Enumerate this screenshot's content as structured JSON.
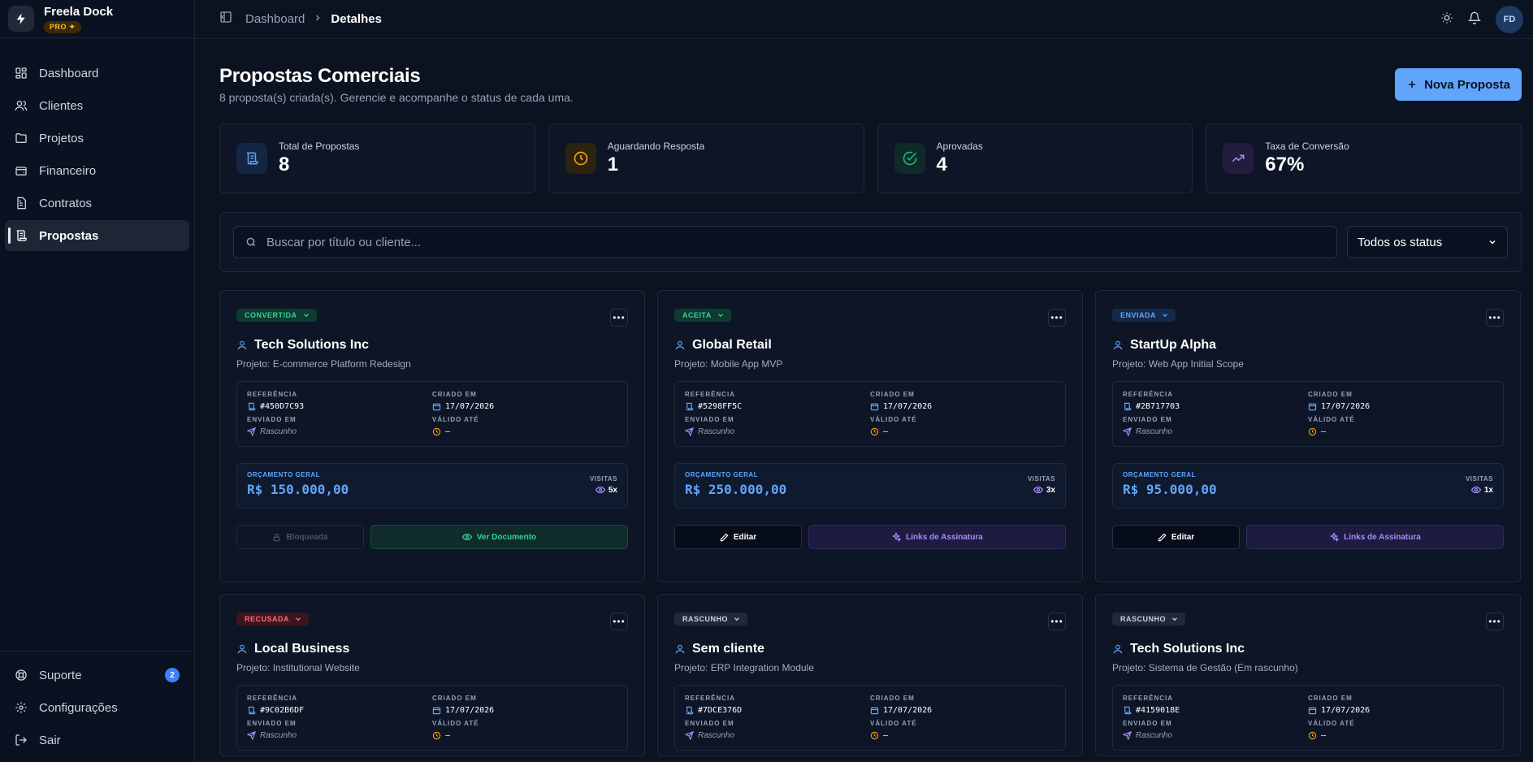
{
  "brand": {
    "name": "Freela Dock",
    "badge": "PRO ✦"
  },
  "sidebar": {
    "items": [
      {
        "label": "Dashboard",
        "icon": "dashboard-icon"
      },
      {
        "label": "Clientes",
        "icon": "users-icon"
      },
      {
        "label": "Projetos",
        "icon": "folder-icon"
      },
      {
        "label": "Financeiro",
        "icon": "wallet-icon"
      },
      {
        "label": "Contratos",
        "icon": "document-icon"
      },
      {
        "label": "Propostas",
        "icon": "scroll-icon",
        "active": true
      }
    ],
    "bottom": [
      {
        "label": "Suporte",
        "icon": "lifebuoy-icon",
        "badge": "2"
      },
      {
        "label": "Configurações",
        "icon": "gear-icon"
      },
      {
        "label": "Sair",
        "icon": "logout-icon"
      }
    ]
  },
  "topbar": {
    "breadcrumb": [
      "Dashboard",
      "Detalhes"
    ],
    "avatar": "FD"
  },
  "page": {
    "title": "Propostas Comerciais",
    "subtitle": "8 proposta(s) criada(s). Gerencie e acompanhe o status de cada uma.",
    "new_button": "Nova Proposta"
  },
  "stats": [
    {
      "label": "Total de Propostas",
      "value": "8",
      "color": "#3b82f6"
    },
    {
      "label": "Aguardando Resposta",
      "value": "1",
      "color": "#f59e0b"
    },
    {
      "label": "Aprovadas",
      "value": "4",
      "color": "#10b981"
    },
    {
      "label": "Taxa de Conversão",
      "value": "67%",
      "color": "#a78bfa"
    }
  ],
  "filters": {
    "search_placeholder": "Buscar por título ou cliente...",
    "status_selected": "Todos os status"
  },
  "labels": {
    "reference": "REFERÊNCIA",
    "created": "CRIADO EM",
    "sent": "ENVIADO EM",
    "valid": "VÁLIDO ATÉ",
    "budget": "ORÇAMENTO GERAL",
    "visits": "VISITAS",
    "locked": "Bloqueada",
    "view": "Ver Documento",
    "edit": "Editar",
    "sign": "Links de Assinatura"
  },
  "proposals": [
    {
      "status": "CONVERTIDA",
      "status_color": "#34d399",
      "status_bg": "#0f3a2e",
      "client": "Tech Solutions Inc",
      "project": "Projeto: E-commerce Platform Redesign",
      "ref": "#450D7C93",
      "created": "17/07/2026",
      "sent": "Rascunho",
      "valid": "—",
      "budget": "R$ 150.000,00",
      "visits": "5x",
      "mode": "converted"
    },
    {
      "status": "ACEITA",
      "status_color": "#34d399",
      "status_bg": "#0f3a2e",
      "client": "Global Retail",
      "project": "Projeto: Mobile App MVP",
      "ref": "#5298FF5C",
      "created": "17/07/2026",
      "sent": "Rascunho",
      "valid": "—",
      "budget": "R$ 250.000,00",
      "visits": "3x",
      "mode": "edit"
    },
    {
      "status": "ENVIADA",
      "status_color": "#60a5fa",
      "status_bg": "#15294a",
      "client": "StartUp Alpha",
      "project": "Projeto: Web App Initial Scope",
      "ref": "#2B717703",
      "created": "17/07/2026",
      "sent": "Rascunho",
      "valid": "—",
      "budget": "R$ 95.000,00",
      "visits": "1x",
      "mode": "edit"
    },
    {
      "status": "RECUSADA",
      "status_color": "#f87171",
      "status_bg": "#3d1520",
      "client": "Local Business",
      "project": "Projeto: Institutional Website",
      "ref": "#9C02B6DF",
      "created": "17/07/2026",
      "sent": "Rascunho",
      "valid": "—"
    },
    {
      "status": "RASCUNHO",
      "status_color": "#cbd5e1",
      "status_bg": "#1f2937",
      "client": "Sem cliente",
      "project": "Projeto: ERP Integration Module",
      "ref": "#7DCE376D",
      "created": "17/07/2026",
      "sent": "Rascunho",
      "valid": "—"
    },
    {
      "status": "RASCUNHO",
      "status_color": "#cbd5e1",
      "status_bg": "#1f2937",
      "client": "Tech Solutions Inc",
      "project": "Projeto: Sistema de Gestão (Em rascunho)",
      "ref": "#4159018E",
      "created": "17/07/2026",
      "sent": "Rascunho",
      "valid": "—"
    }
  ]
}
